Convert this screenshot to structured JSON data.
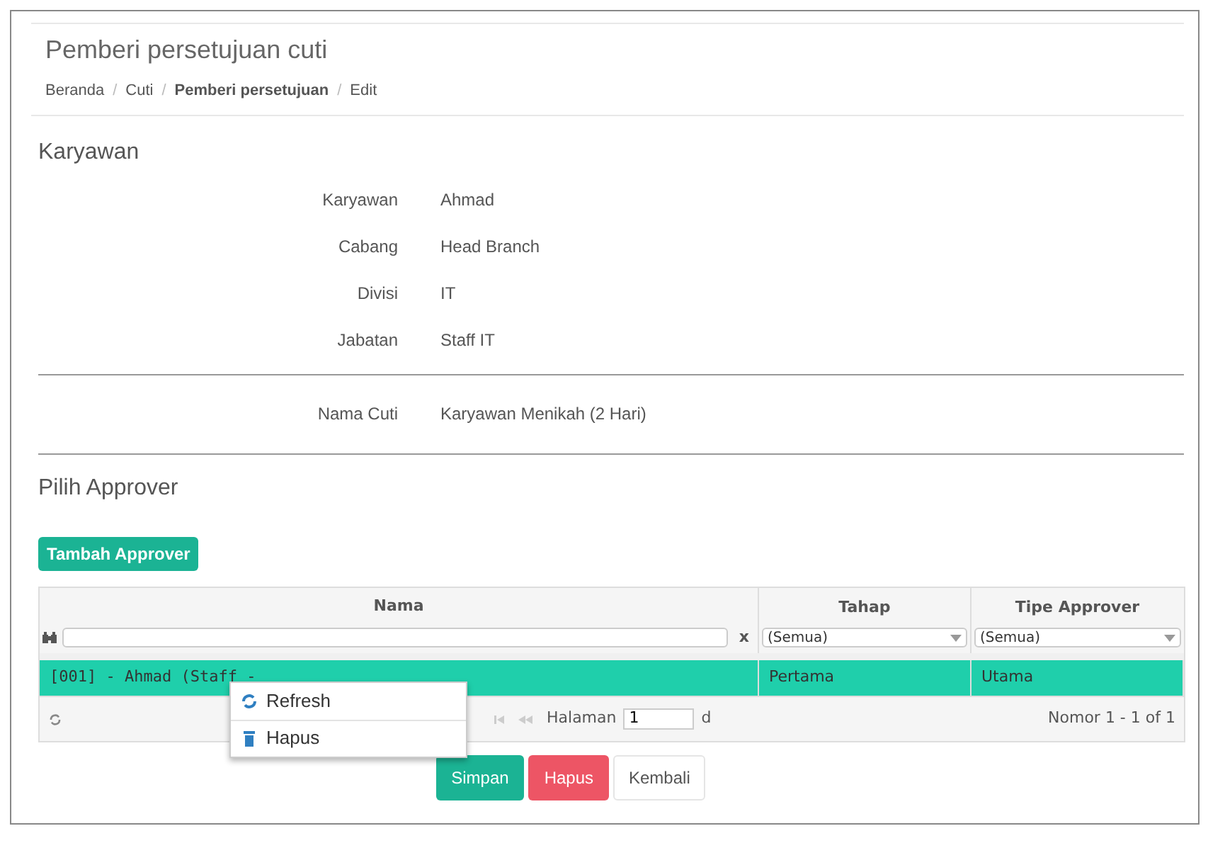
{
  "page": {
    "title": "Pemberi persetujuan cuti"
  },
  "breadcrumb": [
    {
      "label": "Beranda",
      "current": false
    },
    {
      "separator": "/",
      "label": "Cuti",
      "current": false
    },
    {
      "separator": "/",
      "label": "Pemberi persetujuan",
      "current": true
    },
    {
      "separator": "/",
      "label": "Edit",
      "current": false
    }
  ],
  "employee_section": {
    "heading": "Karyawan",
    "fields": [
      {
        "label": "Karyawan",
        "value": "Ahmad"
      },
      {
        "label": "Cabang",
        "value": "Head Branch"
      },
      {
        "label": "Divisi",
        "value": "IT"
      },
      {
        "label": "Jabatan",
        "value": "Staff IT"
      }
    ]
  },
  "leave_fields": [
    {
      "label": "Nama Cuti",
      "value": "Karyawan Menikah (2 Hari)"
    }
  ],
  "approver_section": {
    "heading": "Pilih Approver",
    "add_button": "Tambah Approver"
  },
  "table": {
    "columns": [
      {
        "title": "Nama",
        "kind": "text",
        "clear": "x"
      },
      {
        "title": "Tahap",
        "kind": "select",
        "value": "(Semua)"
      },
      {
        "title": "Tipe Approver",
        "kind": "select",
        "value": "(Semua)"
      }
    ],
    "rows": [
      {
        "cells": [
          "[001] - Ahmad (Staff - ",
          "Pertama",
          "Utama"
        ],
        "selected": true
      }
    ],
    "pager": {
      "page_label": "Halaman",
      "page": "1",
      "of_label": "d",
      "record_info": "Nomor 1 - 1 of 1"
    }
  },
  "context_menu": [
    {
      "kind": "refresh",
      "label": "Refresh"
    },
    {
      "kind": "delete",
      "label": "Hapus"
    }
  ],
  "buttons": [
    {
      "kind": "save",
      "label": "Simpan"
    },
    {
      "kind": "delete",
      "label": "Hapus"
    },
    {
      "kind": "back",
      "label": "Kembali"
    }
  ]
}
